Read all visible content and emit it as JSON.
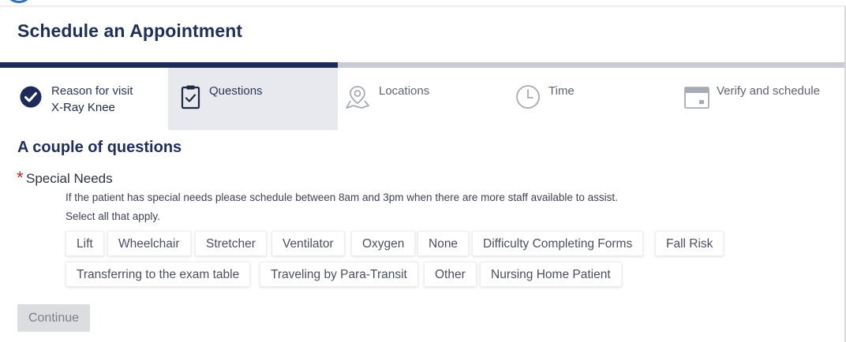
{
  "page": {
    "title": "Schedule an Appointment"
  },
  "progress": {
    "completed_fraction": 0.4
  },
  "steps": [
    {
      "label": "Reason for visit",
      "value": "X-Ray Knee",
      "state": "done",
      "icon": "check-circle-icon"
    },
    {
      "label": "Questions",
      "state": "active",
      "icon": "clipboard-check-icon"
    },
    {
      "label": "Locations",
      "state": "pending",
      "icon": "map-pin-icon"
    },
    {
      "label": "Time",
      "state": "pending",
      "icon": "clock-icon"
    },
    {
      "label": "Verify and schedule",
      "state": "pending",
      "icon": "calendar-icon"
    }
  ],
  "questions": {
    "section_title": "A couple of questions",
    "required_marker": "*",
    "field_label": "Special Needs",
    "help_text": "If the patient has special needs please schedule between 8am and 3pm when there are more staff available to assist.",
    "instruction": "Select all that apply.",
    "options": [
      "Lift",
      "Wheelchair",
      "Stretcher",
      "Ventilator",
      "Oxygen",
      "None",
      "Difficulty Completing Forms",
      "Fall Risk",
      "Transferring to the exam table",
      "Traveling by Para-Transit",
      "Other",
      "Nursing Home Patient"
    ]
  },
  "actions": {
    "continue_label": "Continue"
  },
  "colors": {
    "primary": "#1d2a5a",
    "track": "#c9ccd4",
    "active_step_bg": "#e8e9ee",
    "required": "#c0262d"
  }
}
